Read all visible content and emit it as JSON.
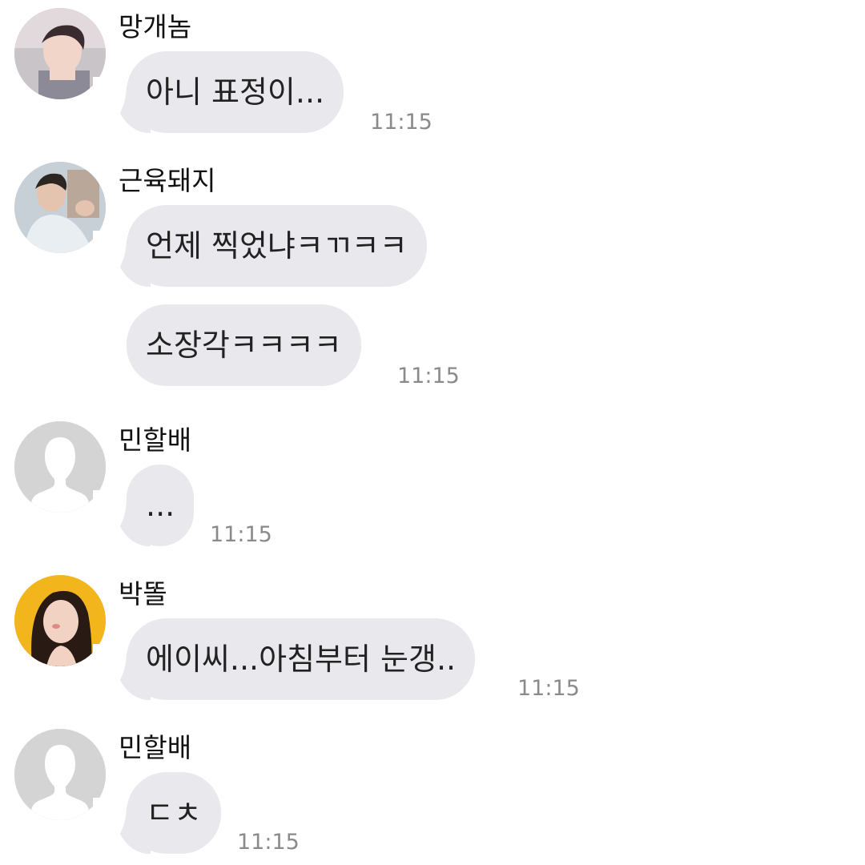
{
  "messages": [
    {
      "sender": "망개놈",
      "avatar_icon": "profile-photo-icon",
      "bubbles": [
        "아니 표정이..."
      ],
      "time": "11:15"
    },
    {
      "sender": "근육돼지",
      "avatar_icon": "profile-photo-icon",
      "bubbles": [
        "언제 찍었냐ㅋㄲㅋㅋ",
        "소장각ㅋㅋㅋㅋ"
      ],
      "time": "11:15"
    },
    {
      "sender": "민할배",
      "avatar_icon": "default-person-icon",
      "bubbles": [
        "..."
      ],
      "time": "11:15"
    },
    {
      "sender": "박똘",
      "avatar_icon": "profile-photo-icon",
      "bubbles": [
        "에이씨...아침부터 눈갱.."
      ],
      "time": "11:15"
    },
    {
      "sender": "민할배",
      "avatar_icon": "default-person-icon",
      "bubbles": [
        "ㄷㅊ"
      ],
      "time": "11:15"
    }
  ],
  "colors": {
    "background": "#ffffff",
    "bubble": "#e8e8ed",
    "timestamp": "#8a8a8a",
    "default_avatar": "#d4d4d4"
  }
}
